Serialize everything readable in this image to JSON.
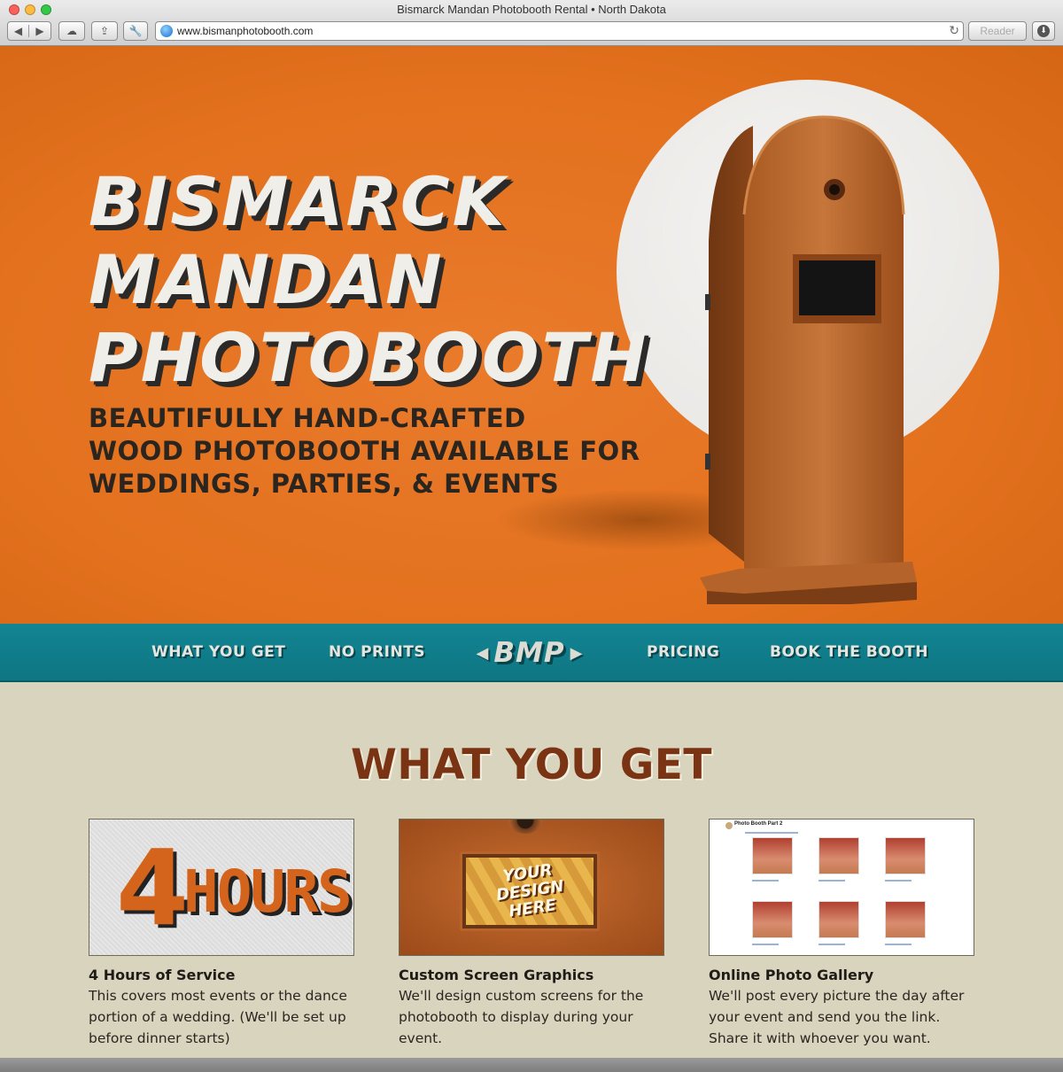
{
  "window": {
    "title": "Bismarck Mandan Photobooth Rental • North Dakota",
    "url": "www.bismanphotobooth.com",
    "reader_label": "Reader"
  },
  "hero": {
    "title_lines": [
      "BISMARCK",
      "MANDAN",
      "PHOTOBOOTH"
    ],
    "subtitle_lines": [
      "BEAUTIFULLY HAND-CRAFTED",
      "WOOD PHOTOBOOTH AVAILABLE FOR",
      "WEDDINGS, PARTIES, & EVENTS"
    ]
  },
  "nav": {
    "items": [
      "WHAT YOU GET",
      "NO PRINTS",
      "PRICING",
      "BOOK THE BOOTH"
    ],
    "logo": "BMP"
  },
  "section": {
    "title": "WHAT YOU GET"
  },
  "cards": [
    {
      "image_text": [
        "4",
        "HOURS"
      ],
      "title": "4 Hours of Service",
      "description": "This covers most events or the dance portion of a wedding. (We'll be set up before dinner starts)"
    },
    {
      "image_text": [
        "YOUR",
        "DESIGN",
        "HERE"
      ],
      "title": "Custom Screen Graphics",
      "description": "We'll design custom screens for the photobooth to display during your event."
    },
    {
      "image_text": [
        "Photo Booth Part 2"
      ],
      "title": "Online Photo Gallery",
      "description": "We'll post every picture the day after your event and send you the link. Share it with whoever you want."
    }
  ],
  "colors": {
    "hero_orange": "#e3711e",
    "nav_teal": "#128593",
    "section_title_brown": "#7a3414",
    "background_beige": "#d9d4bd"
  }
}
